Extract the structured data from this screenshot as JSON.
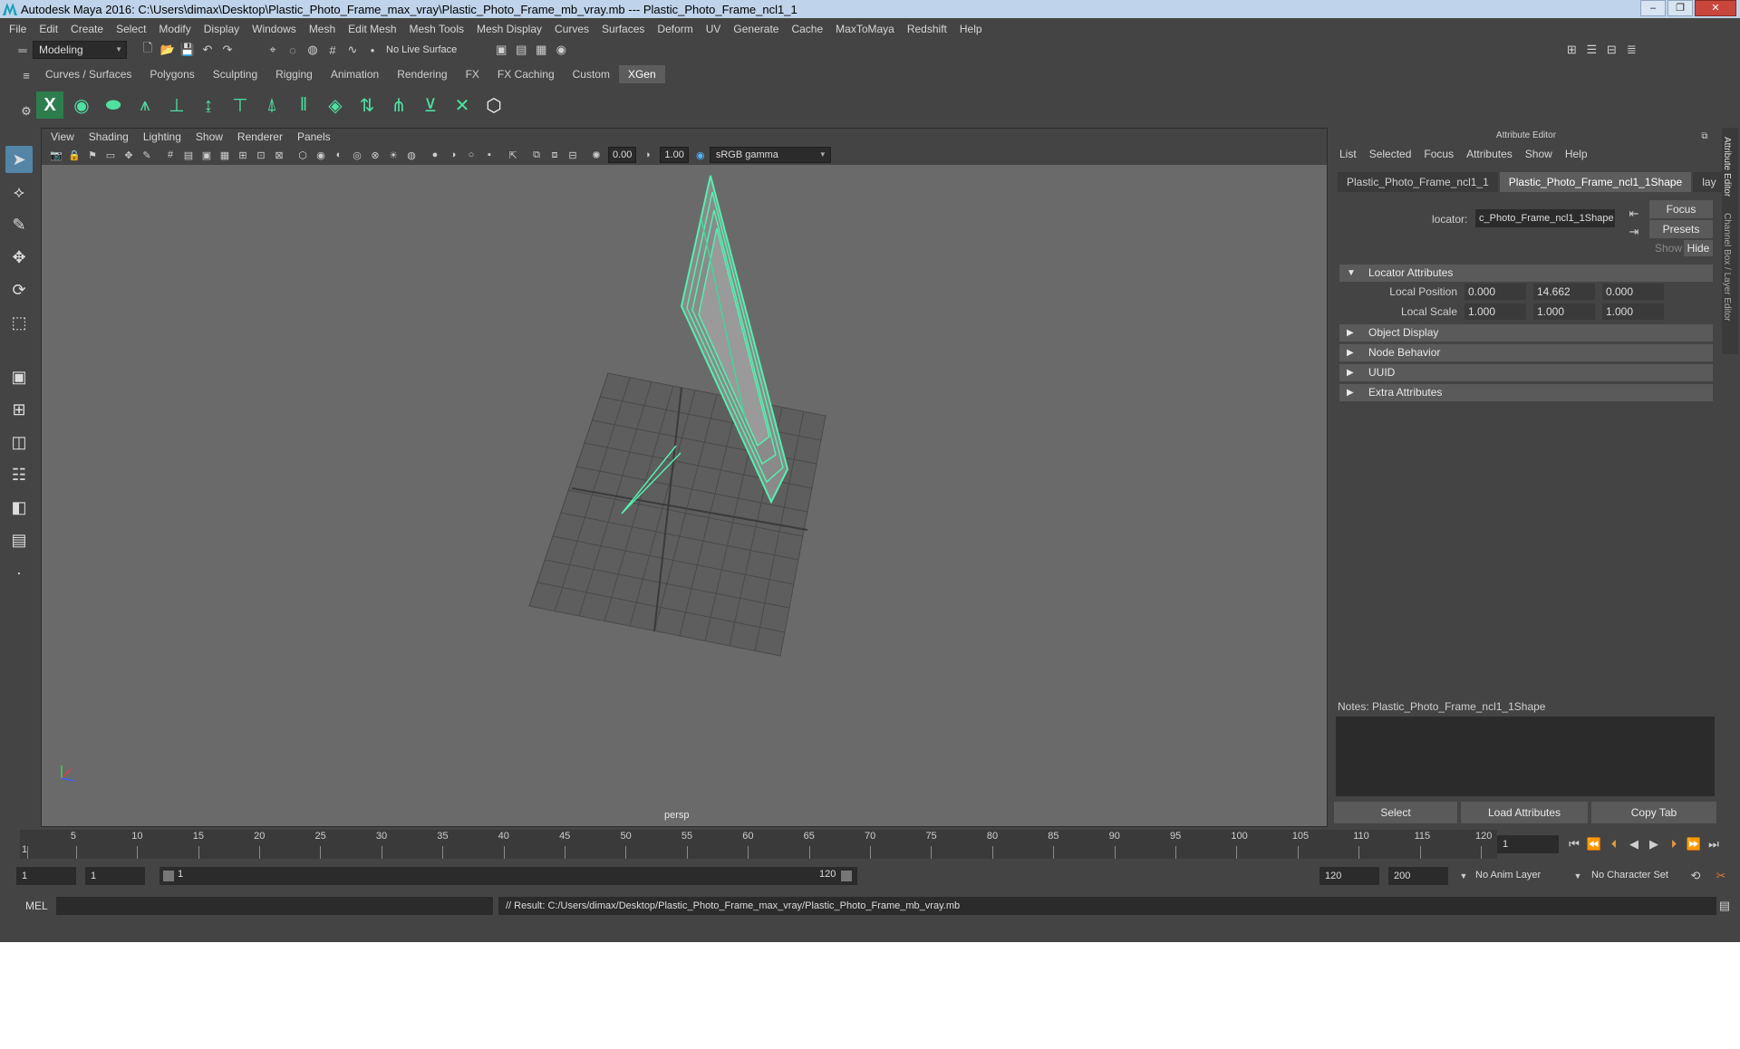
{
  "title": "Autodesk Maya 2016: C:\\Users\\dimax\\Desktop\\Plastic_Photo_Frame_max_vray\\Plastic_Photo_Frame_mb_vray.mb  ---  Plastic_Photo_Frame_ncl1_1",
  "menus": [
    "File",
    "Edit",
    "Create",
    "Select",
    "Modify",
    "Display",
    "Windows",
    "Mesh",
    "Edit Mesh",
    "Mesh Tools",
    "Mesh Display",
    "Curves",
    "Surfaces",
    "Deform",
    "UV",
    "Generate",
    "Cache",
    "MaxToMaya",
    "Redshift",
    "Help"
  ],
  "mode_dropdown": "Modeling",
  "live_surface": "No Live Surface",
  "shelf_tabs": [
    "Curves / Surfaces",
    "Polygons",
    "Sculpting",
    "Rigging",
    "Animation",
    "Rendering",
    "FX",
    "FX Caching",
    "Custom",
    "XGen"
  ],
  "active_shelf_tab": "XGen",
  "viewport": {
    "menus": [
      "View",
      "Shading",
      "Lighting",
      "Show",
      "Renderer",
      "Panels"
    ],
    "exposure": "0.00",
    "gamma": "1.00",
    "colorspace": "sRGB gamma",
    "camera_label": "persp"
  },
  "attribute_editor": {
    "title": "Attribute Editor",
    "menus": [
      "List",
      "Selected",
      "Focus",
      "Attributes",
      "Show",
      "Help"
    ],
    "tabs": [
      "Plastic_Photo_Frame_ncl1_1",
      "Plastic_Photo_Frame_ncl1_1Shape",
      "lay"
    ],
    "active_tab": "Plastic_Photo_Frame_ncl1_1Shape",
    "node_label": "locator:",
    "node_name": "c_Photo_Frame_ncl1_1Shape",
    "buttons": {
      "focus": "Focus",
      "presets": "Presets",
      "show": "Show",
      "hide": "Hide"
    },
    "sections": {
      "locator": "Locator Attributes",
      "object_display": "Object Display",
      "node_behavior": "Node Behavior",
      "uuid": "UUID",
      "extra": "Extra Attributes"
    },
    "local_position": {
      "label": "Local Position",
      "x": "0.000",
      "y": "14.662",
      "z": "0.000"
    },
    "local_scale": {
      "label": "Local Scale",
      "x": "1.000",
      "y": "1.000",
      "z": "1.000"
    },
    "notes_label": "Notes:  Plastic_Photo_Frame_ncl1_1Shape",
    "bottom_buttons": {
      "select": "Select",
      "load": "Load Attributes",
      "copy": "Copy Tab"
    },
    "side_tabs": [
      "Attribute Editor",
      "Channel Box / Layer Editor"
    ]
  },
  "timeline": {
    "ticks": [
      "1",
      "5",
      "10",
      "15",
      "20",
      "25",
      "30",
      "35",
      "40",
      "45",
      "50",
      "55",
      "60",
      "65",
      "70",
      "75",
      "80",
      "85",
      "90",
      "95",
      "100",
      "105",
      "110",
      "115",
      "120"
    ],
    "current_frame": "1"
  },
  "range": {
    "start": "1",
    "start2": "1",
    "slider_left": "1",
    "slider_right": "120",
    "end": "120",
    "end2": "200",
    "anim_layer": "No Anim Layer",
    "char_set": "No Character Set"
  },
  "command": {
    "lang": "MEL",
    "result": "// Result: C:/Users/dimax/Desktop/Plastic_Photo_Frame_max_vray/Plastic_Photo_Frame_mb_vray.mb"
  }
}
